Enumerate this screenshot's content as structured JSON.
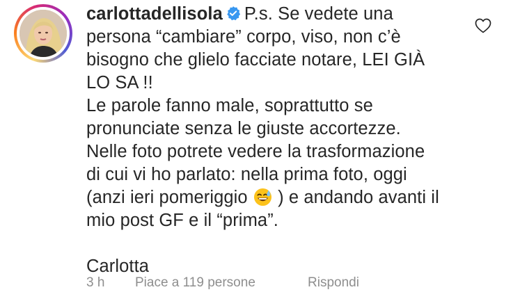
{
  "comment": {
    "username": "carlottadellisola",
    "lines": [
      "P.s. Se vedete una",
      "persona “cambiare” corpo, viso, non c’è",
      "bisogno che glielo facciate notare, LEI GIÀ",
      "LO SA !!",
      "Le parole fanno male, soprattutto se",
      "pronunciate senza le giuste accortezze.",
      "Nelle foto potrete vedere la trasformazione",
      "di cui vi ho parlato: nella prima foto, oggi",
      "(anzi ieri pomeriggio",
      ") e andando avanti il",
      "mio post GF e il “prima”.",
      "Carlotta"
    ],
    "emoji": "sweat-smile-emoji"
  },
  "meta": {
    "time": "3 h",
    "likes": "Piace a 119 persone",
    "reply": "Rispondi"
  },
  "colors": {
    "text": "#262626",
    "muted": "#8e8e8e",
    "verified": "#3897f0"
  }
}
